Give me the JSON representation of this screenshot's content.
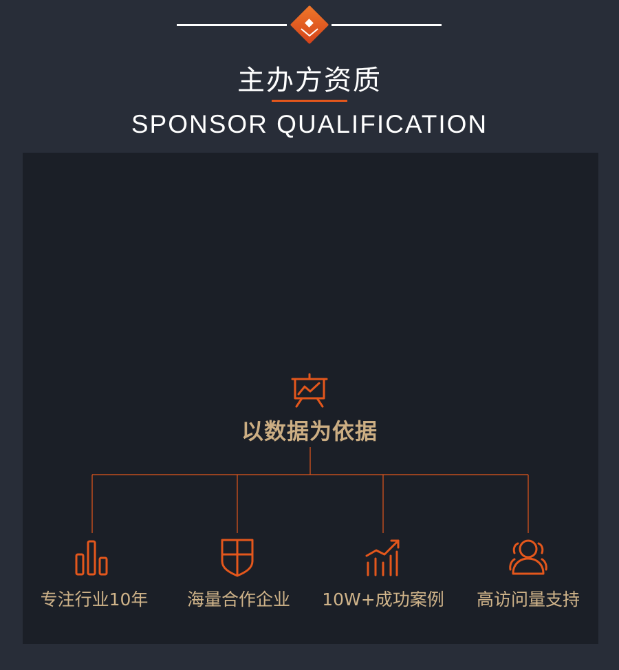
{
  "header": {
    "title": "主办方资质",
    "subtitle": "SPONSOR QUALIFICATION"
  },
  "main": {
    "heading": "以数据为依据",
    "items": [
      {
        "label": "专注行业10年",
        "icon": "bar-chart-icon"
      },
      {
        "label": "海量合作企业",
        "icon": "shield-icon"
      },
      {
        "label": "10W+成功案例",
        "icon": "growth-chart-icon"
      },
      {
        "label": "高访问量支持",
        "icon": "users-icon"
      }
    ]
  },
  "colors": {
    "background": "#282d38",
    "panel": "#1b1f27",
    "accent": "#e4571c",
    "gold_text": "#ccae83",
    "white": "#ffffff"
  }
}
